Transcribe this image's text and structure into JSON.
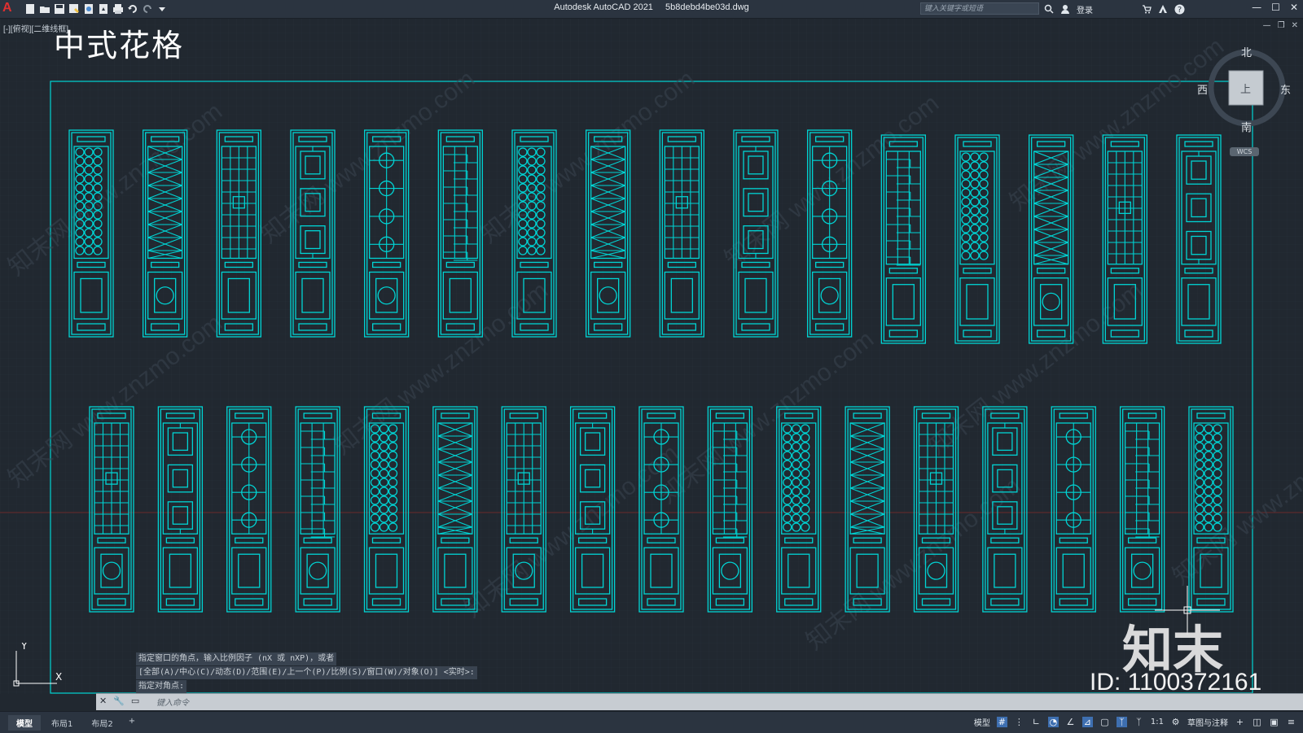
{
  "window": {
    "app_name": "Autodesk AutoCAD 2021",
    "file_name": "5b8debd4be03d.dwg",
    "search_placeholder": "键入关键字或短语",
    "login_label": "登录",
    "viewport_label": "[-][俯视][二维线框]"
  },
  "canvas": {
    "title": "中式花格",
    "watermark_brand": "知末",
    "watermark_id": "ID: 1100372161",
    "watermark_text": "知末网 www.znzmo.com",
    "panel_color": "#00d4d4",
    "background_color": "#212830",
    "panel_count_row1": 16,
    "panel_count_row2": 17
  },
  "viewcube": {
    "north": "北",
    "south": "南",
    "east": "东",
    "west": "西",
    "face": "上",
    "wcs": "WCS"
  },
  "ucs": {
    "x": "X",
    "y": "Y"
  },
  "command": {
    "history": [
      "指定窗口的角点，输入比例因子 (nX 或 nXP)，或者",
      "[全部(A)/中心(C)/动态(D)/范围(E)/上一个(P)/比例(S)/窗口(W)/对象(O)] <实时>:",
      "指定对角点:"
    ],
    "placeholder": "键入命令"
  },
  "status": {
    "tabs": [
      "模型",
      "布局1",
      "布局2"
    ],
    "add_tab": "+",
    "model_label": "模型",
    "scale": "1:1",
    "workspace": "草图与注释"
  }
}
